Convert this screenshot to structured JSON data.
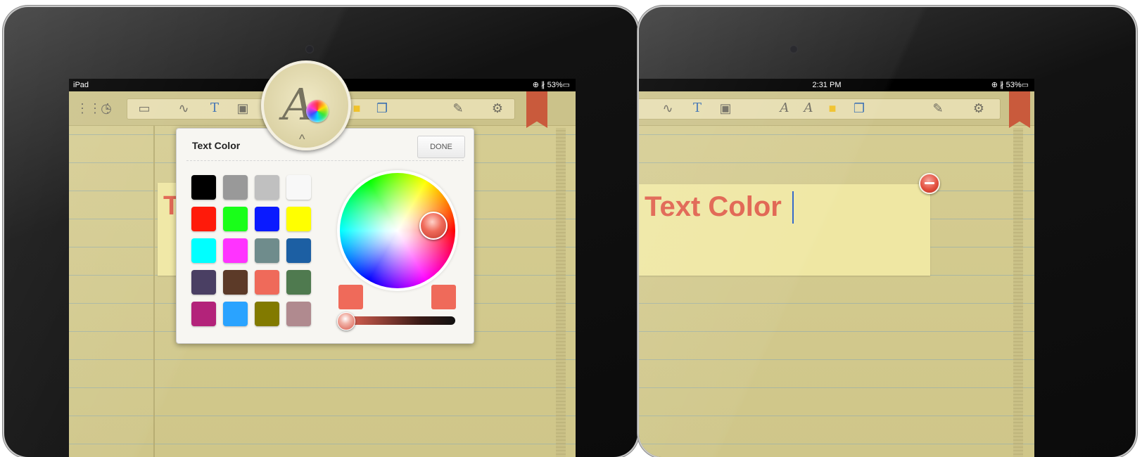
{
  "left_device": {
    "status": {
      "carrier": "iPad",
      "right": "⊕ ∦ 53%▭"
    },
    "popover": {
      "title": "Text Color",
      "done_label": "DONE",
      "swatches": [
        "#000000",
        "#999999",
        "#c0c0c0",
        "#f8f8f8",
        "#ff1a0a",
        "#19ff19",
        "#0a1aff",
        "#ffff00",
        "#00ffff",
        "#ff33ff",
        "#6f8c8c",
        "#1c5fa3",
        "#4a3f63",
        "#5c3a28",
        "#ef6a5a",
        "#4f7a4f",
        "#b3237a",
        "#2aa3ff",
        "#827a00",
        "#b08a8f"
      ],
      "selected_color": "#ef6a5a"
    },
    "note_partial_text": "T"
  },
  "right_device": {
    "status": {
      "time": "2:31 PM",
      "right": "⊕ ∦ 53%▭"
    },
    "note_text": "Text Color"
  },
  "colors": {
    "accent_text": "#e0624e",
    "bookmark": "#c95a3c"
  },
  "icons": {
    "grid": "grid-icon",
    "clock": "clock-icon",
    "keyboard": "keyboard-icon",
    "pen": "pen-icon",
    "text": "text-icon",
    "image": "image-icon",
    "font-size": "font-size-icon",
    "text-color": "text-color-icon",
    "sticky-note": "sticky-note-icon",
    "layers": "layers-icon",
    "edit": "edit-icon",
    "settings": "gear-icon",
    "bookmark": "bookmark-icon"
  }
}
